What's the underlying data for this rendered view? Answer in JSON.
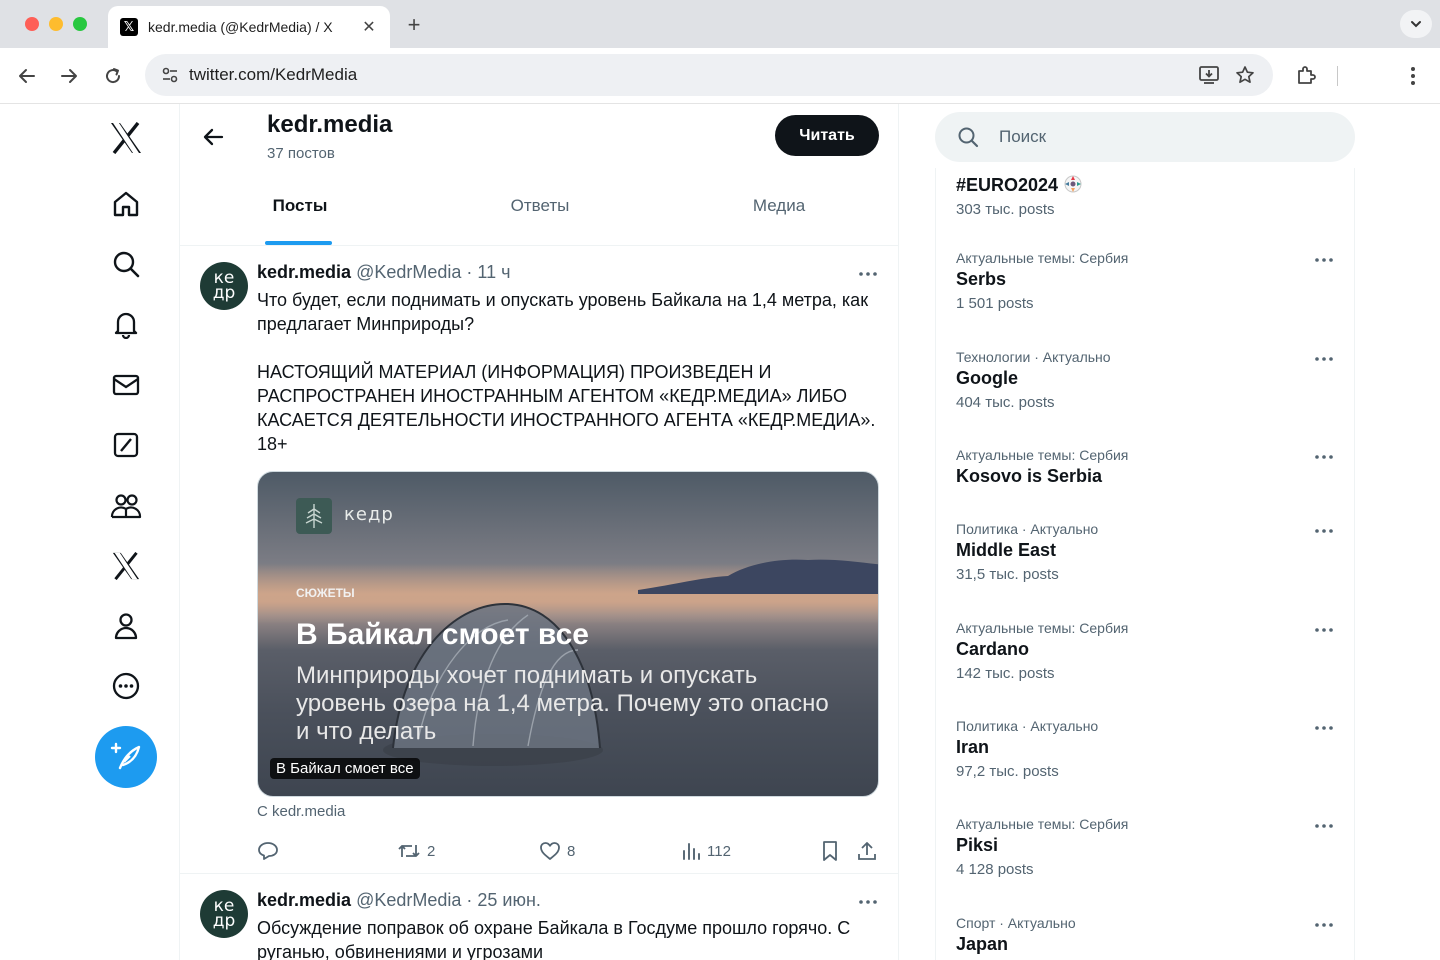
{
  "browser": {
    "tab_title": "kedr.media (@KedrMedia) / X",
    "tab_close": "✕",
    "new_tab": "+",
    "url": "twitter.com/KedrMedia"
  },
  "profile": {
    "name": "kedr.media",
    "posts_count": "37 постов",
    "follow_label": "Читать",
    "tabs": [
      {
        "label": "Посты",
        "active": true
      },
      {
        "label": "Ответы",
        "active": false
      },
      {
        "label": "Медиа",
        "active": false
      }
    ]
  },
  "tweets": [
    {
      "avatar_text": "ке\nдр",
      "name": "kedr.media",
      "handle": "@KedrMedia",
      "time": " · 11 ч",
      "text": "Что будет, если поднимать и опускать уровень Байкала на 1,4 метра, как предлагает Минприроды?\n\nНАСТОЯЩИЙ МАТЕРИАЛ (ИНФОРМАЦИЯ) ПРОИЗВЕДЕН И РАСПРОСТРАНЕН ИНОСТРАННЫМ АГЕНТОМ «КЕДР.МЕДИА» ЛИБО КАСАЕТСЯ ДЕЯТЕЛЬНОСТИ ИНОСТРАННОГО АГЕНТА «КЕДР.МЕДИА». 18+",
      "card": {
        "logo_text": "кедр",
        "kicker": "СЮЖЕТЫ",
        "title": "В Байкал смоет все",
        "subtitle": "Минприроды хочет поднимать и опускать уровень озера на 1,4 метра. Почему это опасно и что делать",
        "label": "В Байкал смоет все",
        "source": "С kedr.media"
      },
      "actions": {
        "reply_count": "",
        "retweet_count": "2",
        "like_count": "8",
        "views_count": "112"
      }
    },
    {
      "avatar_text": "ке\nдр",
      "name": "kedr.media",
      "handle": "@KedrMedia",
      "time": " · 25 июн.",
      "text": "Обсуждение поправок об охране Байкала в Госдуме прошло горячо. С руганью, обвинениями и угрозами"
    }
  ],
  "search": {
    "placeholder": "Поиск"
  },
  "trends": [
    {
      "category": "",
      "name": "#EURO2024",
      "count": "303 тыс. posts"
    },
    {
      "category": "Актуальные темы: Сербия",
      "name": "Serbs",
      "count": "1 501 posts"
    },
    {
      "category": "Технологии · Актуально",
      "name": "Google",
      "count": "404 тыс. posts"
    },
    {
      "category": "Актуальные темы: Сербия",
      "name": "Kosovo is Serbia",
      "count": ""
    },
    {
      "category": "Политика · Актуально",
      "name": "Middle East",
      "count": "31,5 тыс. posts"
    },
    {
      "category": "Актуальные темы: Сербия",
      "name": "Cardano",
      "count": "142 тыс. posts"
    },
    {
      "category": "Политика · Актуально",
      "name": "Iran",
      "count": "97,2 тыс. posts"
    },
    {
      "category": "Актуальные темы: Сербия",
      "name": "Piksi",
      "count": "4 128 posts"
    },
    {
      "category": "Спорт · Актуально",
      "name": "Japan",
      "count": ""
    }
  ],
  "colors": {
    "accent": "#1d9bf0",
    "text_primary": "#0f1419",
    "text_secondary": "#536471",
    "avatar_bg": "#1e3b35"
  },
  "icons": [
    "x-logo-icon",
    "home-icon",
    "search-icon",
    "bell-icon",
    "mail-icon",
    "grok-icon",
    "communities-icon",
    "premium-icon",
    "profile-icon",
    "more-icon",
    "compose-icon"
  ]
}
